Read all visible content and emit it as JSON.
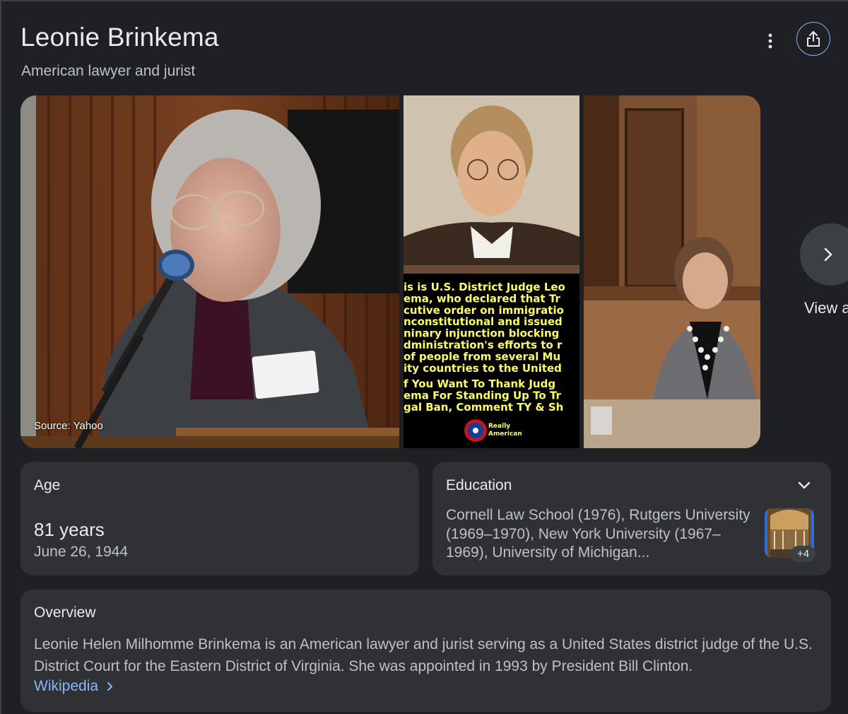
{
  "header": {
    "title": "Leonie Brinkema",
    "subtitle": "American lawyer and jurist",
    "more_icon": "more-vert-icon",
    "share_icon": "share-icon"
  },
  "gallery": {
    "source_label": "Source: Yahoo",
    "view_all_label": "View a",
    "next_icon": "chevron-right-icon",
    "sketch_caption_lines": [
      "is is U.S. District Judge Leo",
      "ema, who declared that Tr",
      "cutive order on immigratio",
      "nconstitutional and issued",
      "ninary injunction blocking",
      "dministration's efforts to r",
      "of people from several Mu",
      "ity countries to the United",
      "f You Want To Thank Judg",
      "ema For Standing Up To Tr",
      "gal Ban, Comment TY & Sh"
    ],
    "sketch_logo": [
      "Really",
      "American"
    ]
  },
  "age": {
    "label": "Age",
    "value": "81 years",
    "birthdate": "June 26, 1944"
  },
  "education": {
    "label": "Education",
    "text": "Cornell Law School (1976), Rutgers University (1969–1970), New York University (1967–1969), University of Michigan...",
    "more_count": "+4",
    "expand_icon": "chevron-down-icon"
  },
  "overview": {
    "label": "Overview",
    "text": "Leonie Helen Milhomme Brinkema is an American lawyer and jurist serving as a United States district judge of the U.S. District Court for the Eastern District of Virginia. She was appointed in 1993 by President Bill Clinton.",
    "link_label": "Wikipedia"
  },
  "colors": {
    "background": "#1f2023",
    "card": "#303134",
    "link": "#8ab4f8",
    "text_primary": "#e8eaed",
    "text_secondary": "#bdc1c6"
  }
}
